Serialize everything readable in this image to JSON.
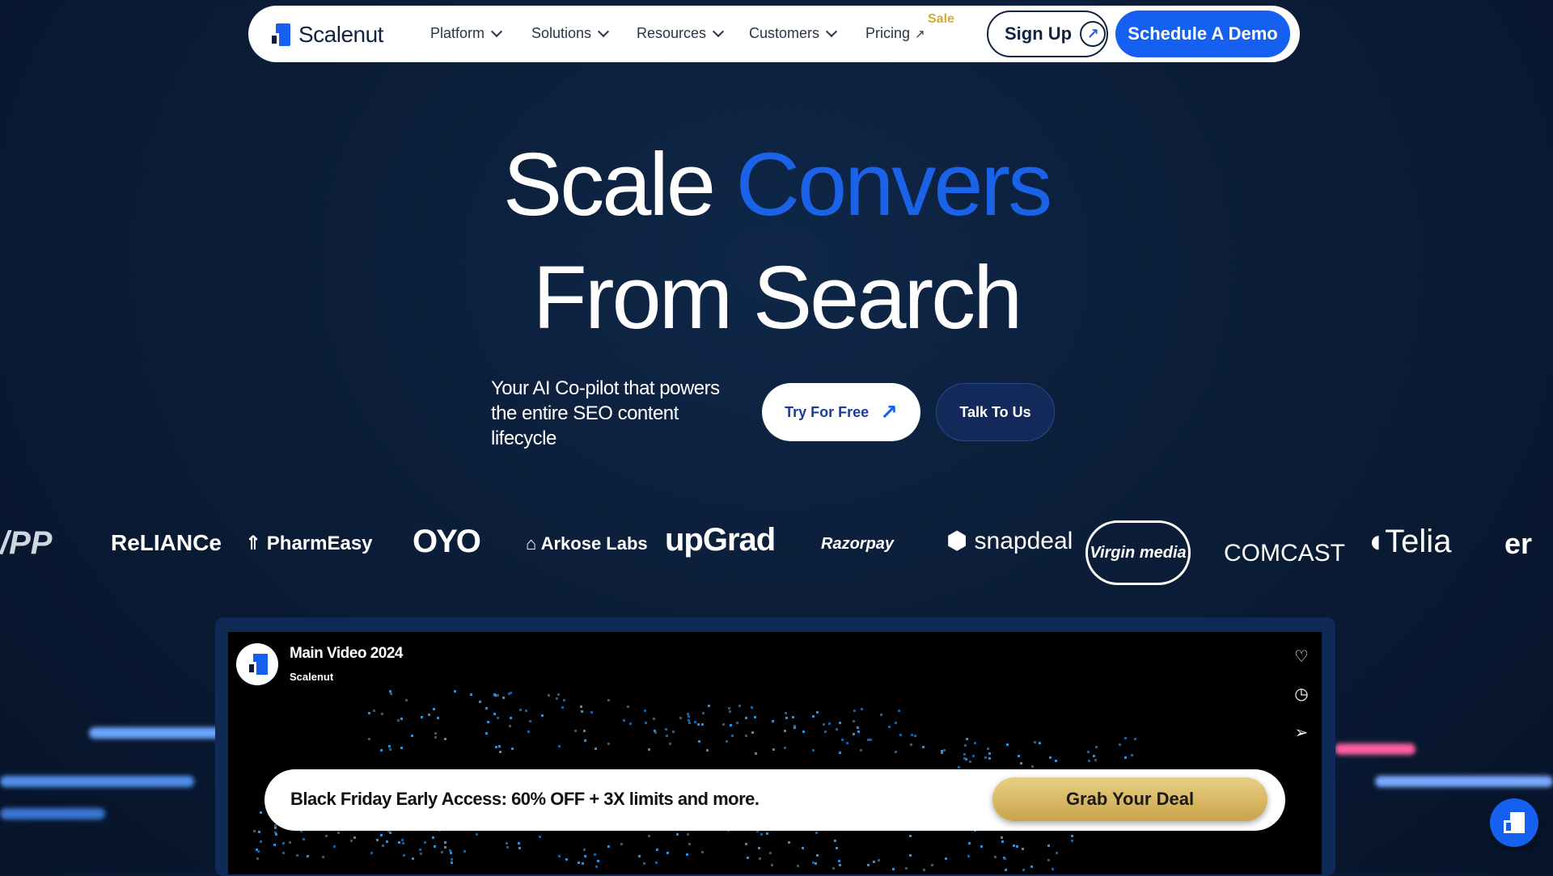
{
  "nav": {
    "brand": "Scalenut",
    "items": [
      {
        "label": "Platform"
      },
      {
        "label": "Solutions"
      },
      {
        "label": "Resources"
      },
      {
        "label": "Customers"
      },
      {
        "label": "Pricing"
      }
    ],
    "sale_badge": "Sale",
    "signup_label": "Sign Up",
    "demo_label": "Schedule A Demo"
  },
  "hero": {
    "title_part1": "Scale",
    "title_part2": "Convers",
    "title_line2": "From Search",
    "subtitle": "Your AI Co-pilot that powers the entire SEO content lifecycle",
    "try_label": "Try For Free",
    "talk_label": "Talk To Us",
    "accent_color": "#1a63e8"
  },
  "logos": [
    "/PP",
    "ReLIANCe",
    "PharmEasy",
    "OYO",
    "Arkose Labs",
    "upGrad",
    "Razorpay",
    "snapdeal",
    "Virgin media",
    "COMCAST",
    "Telia",
    "er"
  ],
  "video": {
    "title": "Main Video 2024",
    "channel": "Scalenut",
    "icons": [
      "heart-icon",
      "clock-icon",
      "share-icon"
    ]
  },
  "deal": {
    "text": "Black Friday Early Access: 60% OFF + 3X limits and more.",
    "button": "Grab Your Deal"
  }
}
